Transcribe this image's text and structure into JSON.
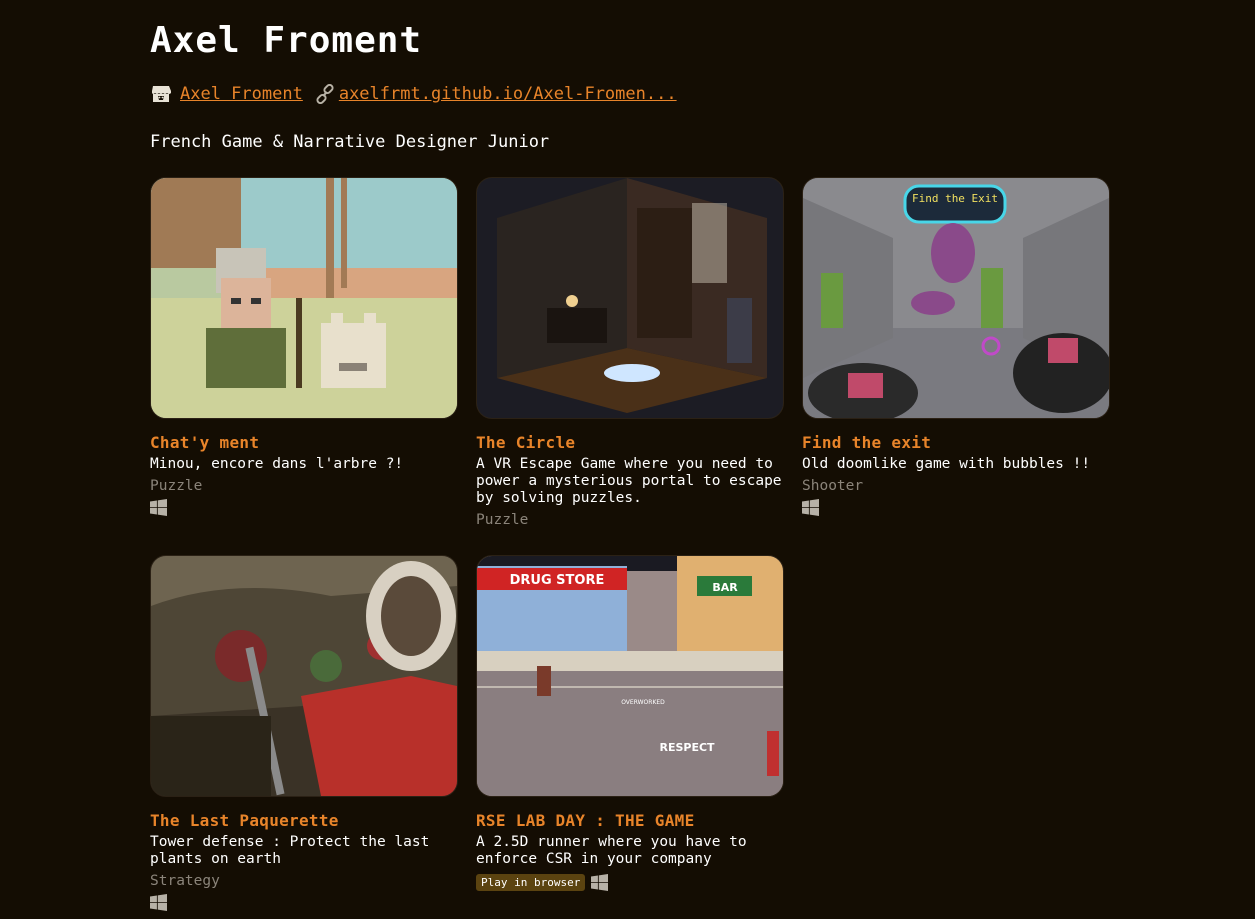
{
  "profile": {
    "name": "Axel Froment",
    "itch_link": "Axel Froment",
    "site_link": "axelfrmt.github.io/Axel-Fromen...",
    "tagline": "French Game & Narrative Designer Junior"
  },
  "games": [
    {
      "title": "Chat'y ment",
      "description": "Minou, encore dans l'arbre ?!",
      "genre": "Puzzle",
      "platform_icon": "windows-icon"
    },
    {
      "title": "The Circle",
      "description": "A VR Escape Game where you need to power a mysterious portal to escape by solving puzzles.",
      "genre": "Puzzle"
    },
    {
      "title": "Find the exit",
      "description": "Old doomlike game with bubbles !!",
      "genre": "Shooter",
      "platform_icon": "windows-icon",
      "thumb_text": "Find the Exit"
    },
    {
      "title": "The Last Paquerette",
      "description": "Tower defense : Protect the last plants on earth",
      "genre": "Strategy",
      "platform_icon": "windows-icon"
    },
    {
      "title": "RSE LAB DAY : THE GAME",
      "description": "A 2.5D runner where you have to enforce CSR in your company",
      "badge": "Play in browser",
      "platform_icon": "windows-icon",
      "thumb_texts": [
        "DRUG STORE",
        "BAR",
        "OVERWORKED",
        "RESPECT"
      ]
    }
  ],
  "colors": {
    "background": "#140d03",
    "accent": "#e8842a",
    "muted": "#8b847a",
    "badge": "#5b4310"
  }
}
